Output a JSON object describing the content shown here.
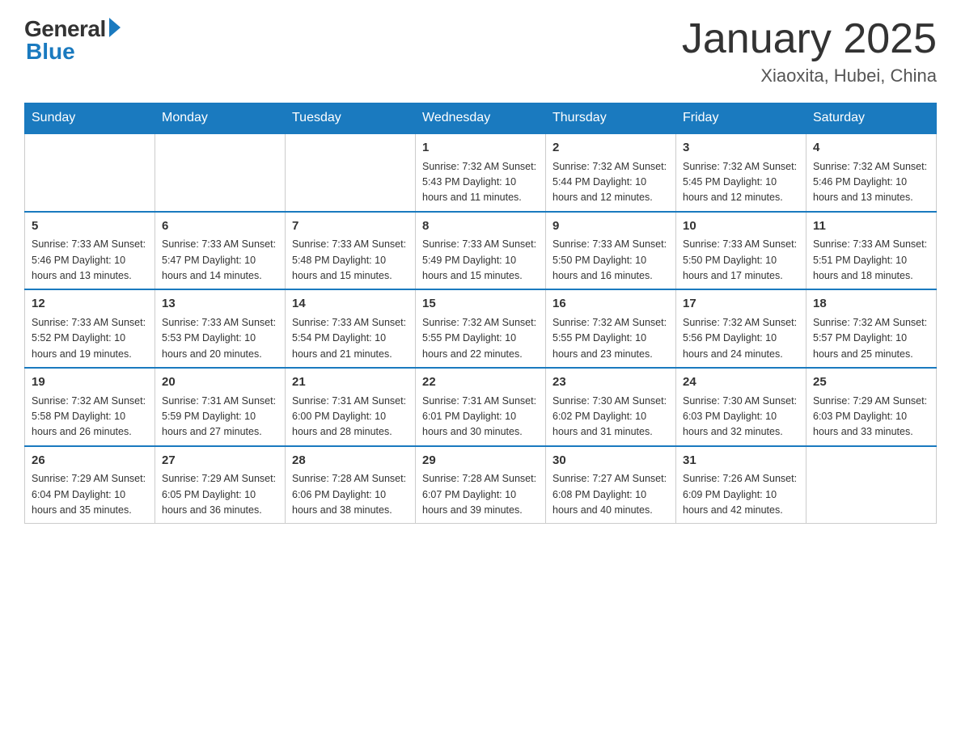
{
  "header": {
    "logo_general": "General",
    "logo_blue": "Blue",
    "month_title": "January 2025",
    "location": "Xiaoxita, Hubei, China"
  },
  "days_of_week": [
    "Sunday",
    "Monday",
    "Tuesday",
    "Wednesday",
    "Thursday",
    "Friday",
    "Saturday"
  ],
  "weeks": [
    [
      {
        "day": "",
        "info": ""
      },
      {
        "day": "",
        "info": ""
      },
      {
        "day": "",
        "info": ""
      },
      {
        "day": "1",
        "info": "Sunrise: 7:32 AM\nSunset: 5:43 PM\nDaylight: 10 hours\nand 11 minutes."
      },
      {
        "day": "2",
        "info": "Sunrise: 7:32 AM\nSunset: 5:44 PM\nDaylight: 10 hours\nand 12 minutes."
      },
      {
        "day": "3",
        "info": "Sunrise: 7:32 AM\nSunset: 5:45 PM\nDaylight: 10 hours\nand 12 minutes."
      },
      {
        "day": "4",
        "info": "Sunrise: 7:32 AM\nSunset: 5:46 PM\nDaylight: 10 hours\nand 13 minutes."
      }
    ],
    [
      {
        "day": "5",
        "info": "Sunrise: 7:33 AM\nSunset: 5:46 PM\nDaylight: 10 hours\nand 13 minutes."
      },
      {
        "day": "6",
        "info": "Sunrise: 7:33 AM\nSunset: 5:47 PM\nDaylight: 10 hours\nand 14 minutes."
      },
      {
        "day": "7",
        "info": "Sunrise: 7:33 AM\nSunset: 5:48 PM\nDaylight: 10 hours\nand 15 minutes."
      },
      {
        "day": "8",
        "info": "Sunrise: 7:33 AM\nSunset: 5:49 PM\nDaylight: 10 hours\nand 15 minutes."
      },
      {
        "day": "9",
        "info": "Sunrise: 7:33 AM\nSunset: 5:50 PM\nDaylight: 10 hours\nand 16 minutes."
      },
      {
        "day": "10",
        "info": "Sunrise: 7:33 AM\nSunset: 5:50 PM\nDaylight: 10 hours\nand 17 minutes."
      },
      {
        "day": "11",
        "info": "Sunrise: 7:33 AM\nSunset: 5:51 PM\nDaylight: 10 hours\nand 18 minutes."
      }
    ],
    [
      {
        "day": "12",
        "info": "Sunrise: 7:33 AM\nSunset: 5:52 PM\nDaylight: 10 hours\nand 19 minutes."
      },
      {
        "day": "13",
        "info": "Sunrise: 7:33 AM\nSunset: 5:53 PM\nDaylight: 10 hours\nand 20 minutes."
      },
      {
        "day": "14",
        "info": "Sunrise: 7:33 AM\nSunset: 5:54 PM\nDaylight: 10 hours\nand 21 minutes."
      },
      {
        "day": "15",
        "info": "Sunrise: 7:32 AM\nSunset: 5:55 PM\nDaylight: 10 hours\nand 22 minutes."
      },
      {
        "day": "16",
        "info": "Sunrise: 7:32 AM\nSunset: 5:55 PM\nDaylight: 10 hours\nand 23 minutes."
      },
      {
        "day": "17",
        "info": "Sunrise: 7:32 AM\nSunset: 5:56 PM\nDaylight: 10 hours\nand 24 minutes."
      },
      {
        "day": "18",
        "info": "Sunrise: 7:32 AM\nSunset: 5:57 PM\nDaylight: 10 hours\nand 25 minutes."
      }
    ],
    [
      {
        "day": "19",
        "info": "Sunrise: 7:32 AM\nSunset: 5:58 PM\nDaylight: 10 hours\nand 26 minutes."
      },
      {
        "day": "20",
        "info": "Sunrise: 7:31 AM\nSunset: 5:59 PM\nDaylight: 10 hours\nand 27 minutes."
      },
      {
        "day": "21",
        "info": "Sunrise: 7:31 AM\nSunset: 6:00 PM\nDaylight: 10 hours\nand 28 minutes."
      },
      {
        "day": "22",
        "info": "Sunrise: 7:31 AM\nSunset: 6:01 PM\nDaylight: 10 hours\nand 30 minutes."
      },
      {
        "day": "23",
        "info": "Sunrise: 7:30 AM\nSunset: 6:02 PM\nDaylight: 10 hours\nand 31 minutes."
      },
      {
        "day": "24",
        "info": "Sunrise: 7:30 AM\nSunset: 6:03 PM\nDaylight: 10 hours\nand 32 minutes."
      },
      {
        "day": "25",
        "info": "Sunrise: 7:29 AM\nSunset: 6:03 PM\nDaylight: 10 hours\nand 33 minutes."
      }
    ],
    [
      {
        "day": "26",
        "info": "Sunrise: 7:29 AM\nSunset: 6:04 PM\nDaylight: 10 hours\nand 35 minutes."
      },
      {
        "day": "27",
        "info": "Sunrise: 7:29 AM\nSunset: 6:05 PM\nDaylight: 10 hours\nand 36 minutes."
      },
      {
        "day": "28",
        "info": "Sunrise: 7:28 AM\nSunset: 6:06 PM\nDaylight: 10 hours\nand 38 minutes."
      },
      {
        "day": "29",
        "info": "Sunrise: 7:28 AM\nSunset: 6:07 PM\nDaylight: 10 hours\nand 39 minutes."
      },
      {
        "day": "30",
        "info": "Sunrise: 7:27 AM\nSunset: 6:08 PM\nDaylight: 10 hours\nand 40 minutes."
      },
      {
        "day": "31",
        "info": "Sunrise: 7:26 AM\nSunset: 6:09 PM\nDaylight: 10 hours\nand 42 minutes."
      },
      {
        "day": "",
        "info": ""
      }
    ]
  ]
}
